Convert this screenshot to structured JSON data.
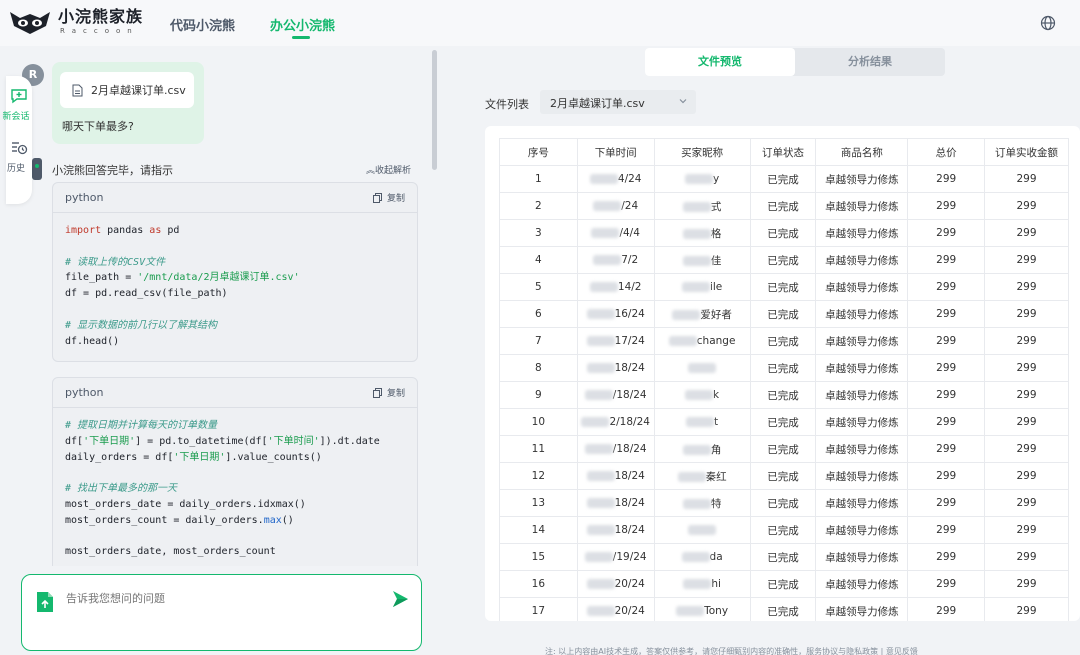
{
  "brand": {
    "title": "小浣熊家族",
    "subtitle": "Raccoon"
  },
  "nav": {
    "tab1": "代码小浣熊",
    "tab2": "办公小浣熊"
  },
  "rail": {
    "new_chat": "新会话",
    "history": "历史"
  },
  "user": {
    "avatar": "R",
    "file_name": "2月卓越课订单.csv",
    "question": "哪天下单最多?"
  },
  "bot": {
    "status": "小浣熊回答完毕，请指示",
    "collapse": "收起解析"
  },
  "code_blocks": [
    {
      "lang": "python",
      "copy": "复制"
    },
    {
      "lang": "python",
      "copy": "复制"
    }
  ],
  "input": {
    "placeholder": "告诉我您想问的问题"
  },
  "right": {
    "tab_preview": "文件预览",
    "tab_result": "分析结果",
    "file_list_label": "文件列表",
    "file_selected": "2月卓越课订单.csv"
  },
  "table": {
    "headers": [
      "序号",
      "下单时间",
      "买家昵称",
      "订单状态",
      "商品名称",
      "总价",
      "订单实收金额"
    ],
    "rows": [
      [
        "1",
        "4/24",
        "y",
        "已完成",
        "卓越领导力修炼",
        "299",
        "299"
      ],
      [
        "2",
        "/24",
        "式",
        "已完成",
        "卓越领导力修炼",
        "299",
        "299"
      ],
      [
        "3",
        "/4/4",
        "格",
        "已完成",
        "卓越领导力修炼",
        "299",
        "299"
      ],
      [
        "4",
        "7/2",
        "佳",
        "已完成",
        "卓越领导力修炼",
        "299",
        "299"
      ],
      [
        "5",
        "14/2",
        "ile",
        "已完成",
        "卓越领导力修炼",
        "299",
        "299"
      ],
      [
        "6",
        "16/24",
        "爱好者",
        "已完成",
        "卓越领导力修炼",
        "299",
        "299"
      ],
      [
        "7",
        "17/24",
        "change",
        "已完成",
        "卓越领导力修炼",
        "299",
        "299"
      ],
      [
        "8",
        "18/24",
        "",
        "已完成",
        "卓越领导力修炼",
        "299",
        "299"
      ],
      [
        "9",
        "/18/24",
        "k",
        "已完成",
        "卓越领导力修炼",
        "299",
        "299"
      ],
      [
        "10",
        "2/18/24",
        "t",
        "已完成",
        "卓越领导力修炼",
        "299",
        "299"
      ],
      [
        "11",
        "/18/24",
        "角",
        "已完成",
        "卓越领导力修炼",
        "299",
        "299"
      ],
      [
        "12",
        "18/24",
        "秦红",
        "已完成",
        "卓越领导力修炼",
        "299",
        "299"
      ],
      [
        "13",
        "18/24",
        "特",
        "已完成",
        "卓越领导力修炼",
        "299",
        "299"
      ],
      [
        "14",
        "18/24",
        "",
        "已完成",
        "卓越领导力修炼",
        "299",
        "299"
      ],
      [
        "15",
        "/19/24",
        "da",
        "已完成",
        "卓越领导力修炼",
        "299",
        "299"
      ],
      [
        "16",
        "20/24",
        "hi",
        "已完成",
        "卓越领导力修炼",
        "299",
        "299"
      ],
      [
        "17",
        "20/24",
        "Tony",
        "已完成",
        "卓越领导力修炼",
        "299",
        "299"
      ]
    ]
  },
  "footer": {
    "note": "注: 以上内容由AI技术生成，答案仅供参考，请您仔细甄别内容的准确性，服务协议与隐私政策 | 意见反馈"
  },
  "colors": {
    "accent": "#14b86e"
  }
}
